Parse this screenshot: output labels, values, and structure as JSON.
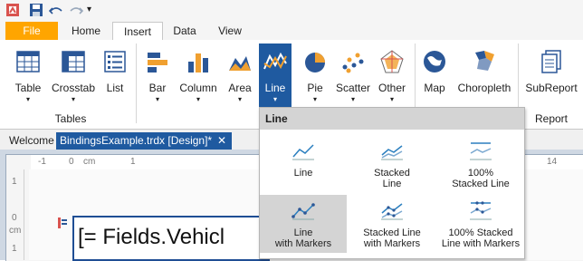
{
  "quick_access": {
    "customize_arrow": "▾"
  },
  "tabs": [
    {
      "label": "File"
    },
    {
      "label": "Home"
    },
    {
      "label": "Insert"
    },
    {
      "label": "Data"
    },
    {
      "label": "View"
    }
  ],
  "ribbon": {
    "buttons": [
      {
        "label": "Table",
        "arrow": "▾"
      },
      {
        "label": "Crosstab",
        "arrow": "▾"
      },
      {
        "label": "List"
      },
      {
        "label": "Bar",
        "arrow": "▾"
      },
      {
        "label": "Column",
        "arrow": "▾"
      },
      {
        "label": "Area",
        "arrow": "▾"
      },
      {
        "label": "Line",
        "arrow": "▾"
      },
      {
        "label": "Pie",
        "arrow": "▾"
      },
      {
        "label": "Scatter",
        "arrow": "▾"
      },
      {
        "label": "Other",
        "arrow": "▾"
      },
      {
        "label": "Map"
      },
      {
        "label": "Choropleth"
      },
      {
        "label": "SubReport"
      }
    ],
    "groups": {
      "tables": "Tables",
      "report": "Report"
    }
  },
  "doc_tabs": {
    "welcome": "Welcome",
    "active": "BindingsExample.trdx [Design]*",
    "close": "✕"
  },
  "ruler": {
    "marks": [
      "-1",
      "0",
      "cm",
      "1",
      "14"
    ],
    "vmarks": [
      "1",
      "0",
      "cm",
      "1"
    ]
  },
  "designer": {
    "field_text": "[= Fields.Vehicl"
  },
  "dropdown": {
    "title": "Line",
    "items": [
      {
        "line1": "Line",
        "line2": ""
      },
      {
        "line1": "Stacked",
        "line2": "Line"
      },
      {
        "line1": "100%",
        "line2": "Stacked Line"
      },
      {
        "line1": "Line",
        "line2": "with Markers"
      },
      {
        "line1": "Stacked Line",
        "line2": "with Markers"
      },
      {
        "line1": "100% Stacked",
        "line2": "Line with Markers"
      }
    ]
  },
  "colors": {
    "file_tab": "#ffa500",
    "selected": "#1f5aa0",
    "highlight": "#d4d4d4"
  }
}
